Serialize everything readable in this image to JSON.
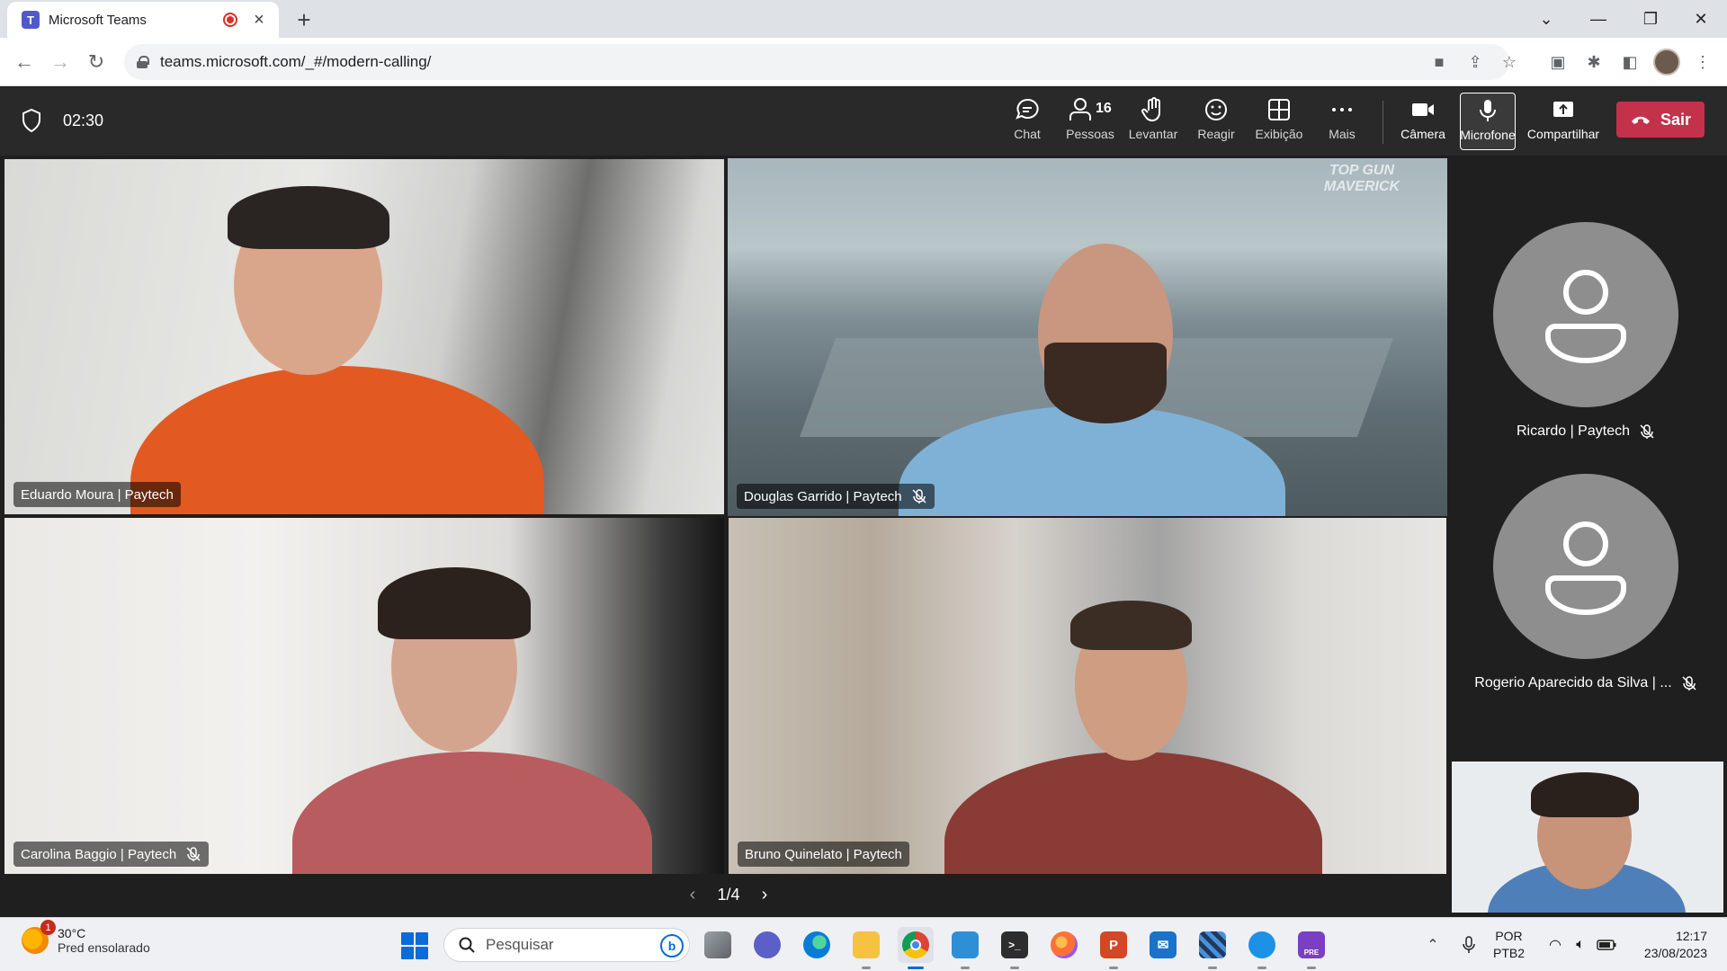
{
  "browser": {
    "tab_title": "Microsoft Teams",
    "tab_favicon": "T",
    "url": "teams.microsoft.com/_#/modern-calling/"
  },
  "meeting": {
    "timer": "02:30",
    "toolbar": {
      "chat": "Chat",
      "people": "Pessoas",
      "people_count": "16",
      "raise": "Levantar",
      "react": "Reagir",
      "view": "Exibição",
      "more": "Mais",
      "camera": "Câmera",
      "mic": "Microfone",
      "share": "Compartilhar",
      "leave": "Sair"
    },
    "tiles": [
      {
        "name": "Eduardo Moura | Paytech",
        "muted": false,
        "speaking": true
      },
      {
        "name": "Douglas Garrido | Paytech",
        "muted": true,
        "speaking": false,
        "background_text": "TOP GUN MAVERICK"
      },
      {
        "name": "Carolina Baggio | Paytech",
        "muted": true,
        "speaking": false
      },
      {
        "name": "Bruno Quinelato | Paytech",
        "muted": false,
        "speaking": true
      }
    ],
    "roster": [
      {
        "name": "Ricardo | Paytech",
        "muted": true
      },
      {
        "name": "Rogerio Aparecido da Silva | ...",
        "muted": true
      }
    ],
    "pager": "1/4",
    "colors": {
      "speaking_outline": "#7b83eb",
      "leave": "#c4314b",
      "toolbar": "#292929",
      "stage": "#1f1f1f"
    }
  },
  "taskbar": {
    "weather_temp": "30°C",
    "weather_desc": "Pred ensolarado",
    "weather_badge": "1",
    "search_placeholder": "Pesquisar",
    "lang_top": "POR",
    "lang_bottom": "PTB2",
    "time": "12:17",
    "date": "23/08/2023",
    "apps": [
      "task-view",
      "teams-chat",
      "edge",
      "file-explorer",
      "chrome",
      "azure-data",
      "terminal",
      "firefox",
      "powerpoint",
      "mail",
      "visual-studio-code-insiders",
      "docker",
      "visual-studio-preview"
    ],
    "pre_badge": "PRE"
  }
}
